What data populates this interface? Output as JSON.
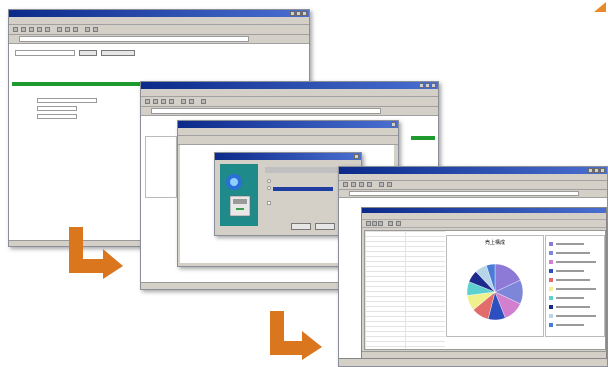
{
  "chart_data": {
    "type": "pie",
    "title": "売上構成",
    "values": [
      18,
      14,
      12,
      10,
      10,
      9,
      8,
      7,
      7,
      5
    ],
    "legend_placement": "right"
  },
  "pie_colors": [
    "#8c7ad6",
    "#7d86d9",
    "#d27fcf",
    "#2d4fbf",
    "#e26c6c",
    "#f0f08c",
    "#5fd0d0",
    "#1b2a8c",
    "#b7d4e8",
    "#4a7bd8"
  ]
}
